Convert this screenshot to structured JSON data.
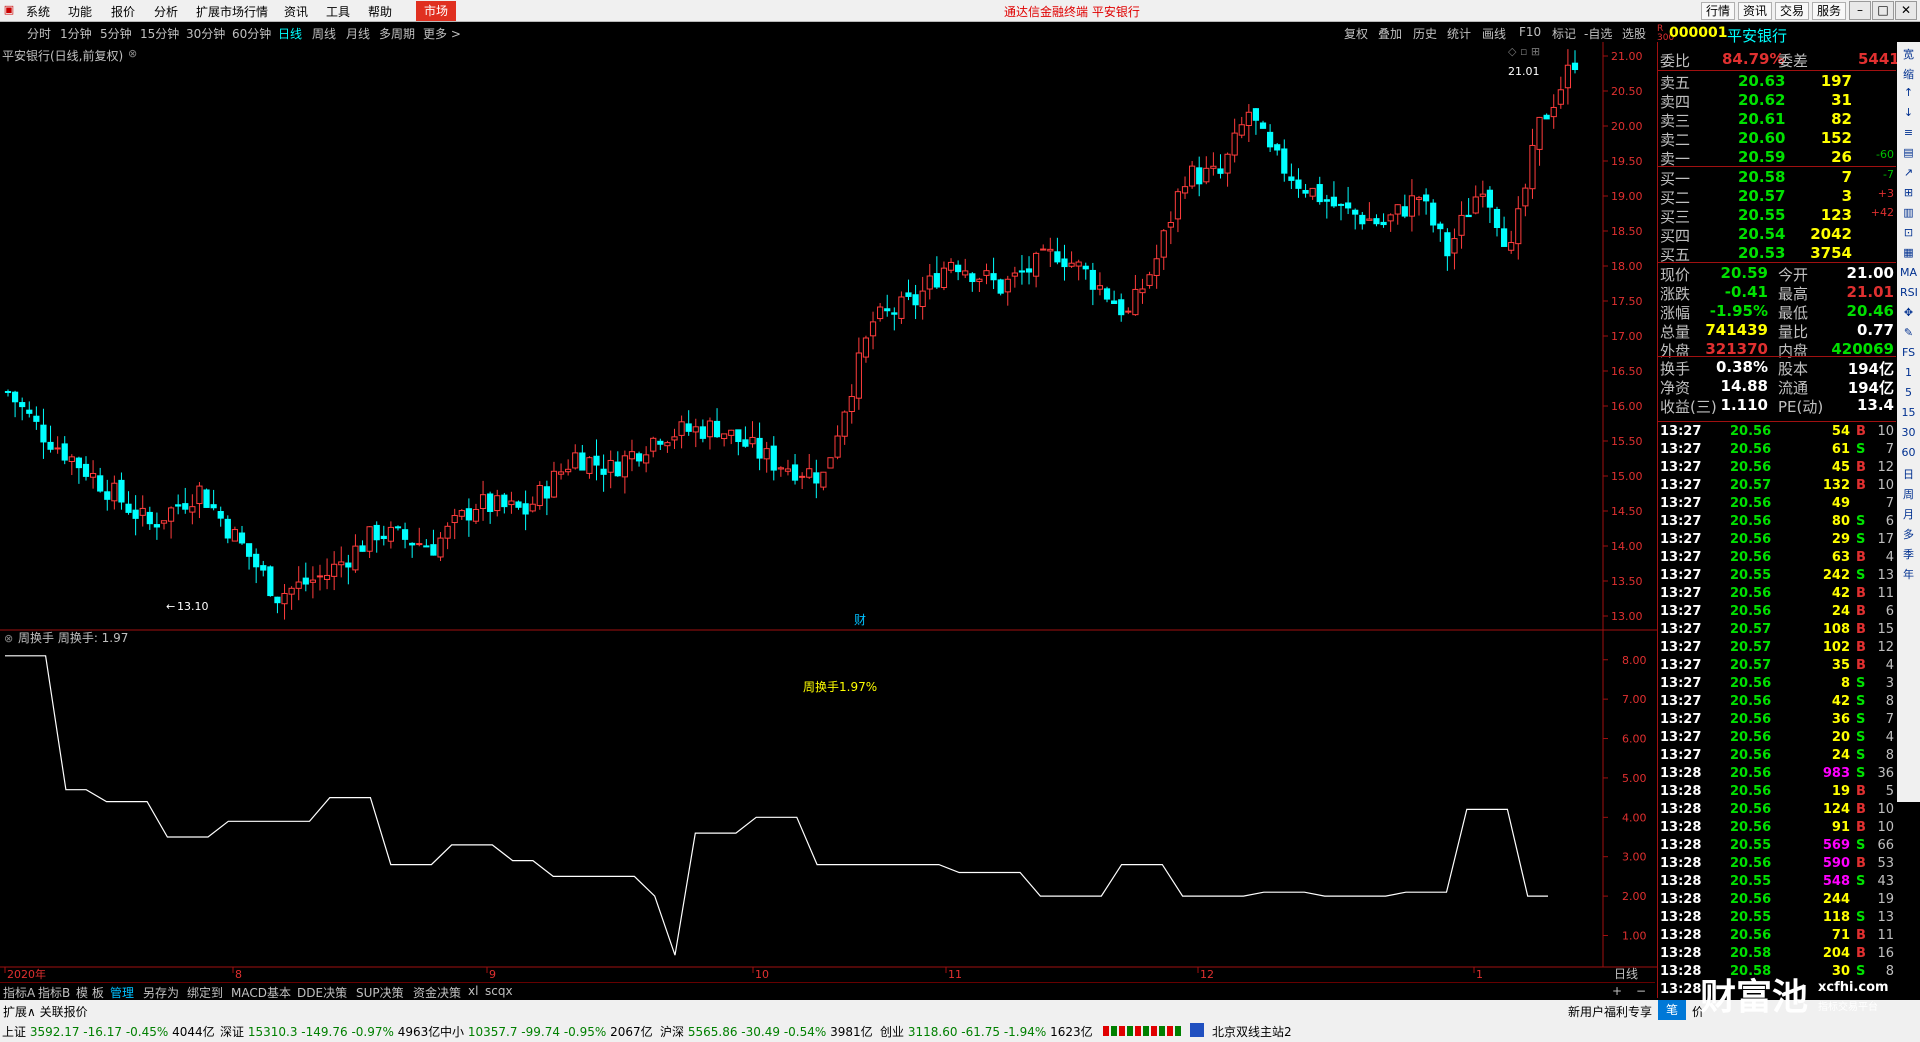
{
  "menu": {
    "items": [
      "系统",
      "功能",
      "报价",
      "分析",
      "扩展市场行情",
      "资讯",
      "工具",
      "帮助"
    ],
    "market_tab": "市场",
    "brand": "通达信金融终端  平安银行",
    "right_buttons": [
      "行情",
      "资讯",
      "交易",
      "服务"
    ],
    "window_controls": [
      "–",
      "□",
      "✕"
    ]
  },
  "period_bar": {
    "periods": [
      "分时",
      "1分钟",
      "5分钟",
      "15分钟",
      "30分钟",
      "60分钟",
      "日线",
      "周线",
      "月线",
      "多周期",
      "更多 >"
    ],
    "active": "日线",
    "tools": [
      "复权",
      "叠加",
      "历史",
      "统计",
      "画线",
      "F10",
      "标记",
      "-自选",
      "选股"
    ]
  },
  "chart_title": "平安银行(日线,前复权)",
  "chart_annotations": {
    "high_label": "21.01",
    "low_label": "13.10",
    "fin_marker": "财"
  },
  "indicator": {
    "title": "周换手  周换手: 1.97",
    "center_label": "周换手1.97%",
    "y_ticks": [
      "8.00",
      "7.00",
      "6.00",
      "5.00",
      "4.00",
      "3.00",
      "2.00",
      "1.00"
    ]
  },
  "price_y_ticks": [
    "21.00",
    "20.50",
    "20.00",
    "19.50",
    "19.00",
    "18.50",
    "18.00",
    "17.50",
    "17.00",
    "16.50",
    "16.00",
    "15.50",
    "15.00",
    "14.50",
    "14.00",
    "13.50",
    "13.00"
  ],
  "x_axis": {
    "labels": [
      "2020年",
      "8",
      "9",
      "10",
      "11",
      "12",
      "1"
    ],
    "period_label": "日线"
  },
  "colors": {
    "up": "#ff3c3c",
    "down": "#00ffff",
    "line": "#ffffff",
    "label_yellow": "#ffff00",
    "grid_red": "#a01010"
  },
  "chart_data": {
    "type": "candlestick",
    "ylim": [
      12.8,
      21.2
    ],
    "high": 21.01,
    "low": 13.1,
    "last_close": 20.59,
    "indicator_series": {
      "name": "周换手",
      "ylim": [
        0.2,
        8.4
      ],
      "values": [
        8.1,
        8.1,
        8.1,
        4.7,
        4.7,
        4.4,
        4.4,
        4.4,
        3.5,
        3.5,
        3.5,
        3.9,
        3.9,
        3.9,
        3.9,
        3.9,
        4.5,
        4.5,
        4.5,
        2.8,
        2.8,
        2.8,
        3.3,
        3.3,
        3.3,
        2.9,
        2.9,
        2.5,
        2.5,
        2.5,
        2.5,
        2.5,
        2.0,
        0.5,
        3.6,
        3.6,
        3.6,
        4.0,
        4.0,
        4.0,
        2.8,
        2.8,
        2.8,
        2.8,
        2.8,
        2.8,
        2.8,
        2.6,
        2.6,
        2.6,
        2.6,
        2.0,
        2.0,
        2.0,
        2.0,
        2.8,
        2.8,
        2.8,
        2.0,
        2.0,
        2.0,
        2.0,
        2.1,
        2.1,
        2.1,
        2.0,
        2.0,
        2.0,
        2.0,
        2.1,
        2.1,
        2.1,
        4.2,
        4.2,
        4.2,
        2.0,
        2.0
      ]
    }
  },
  "quote": {
    "code": "000001",
    "name": "平安银行",
    "weibi_label": "委比",
    "weibi": "84.79%",
    "weicha_label": "委差",
    "weicha": "5441",
    "asks": [
      {
        "label": "卖五",
        "price": "20.63",
        "vol": "197",
        "chg": ""
      },
      {
        "label": "卖四",
        "price": "20.62",
        "vol": "31",
        "chg": ""
      },
      {
        "label": "卖三",
        "price": "20.61",
        "vol": "82",
        "chg": ""
      },
      {
        "label": "卖二",
        "price": "20.60",
        "vol": "152",
        "chg": ""
      },
      {
        "label": "卖一",
        "price": "20.59",
        "vol": "26",
        "chg": "-60"
      }
    ],
    "bids": [
      {
        "label": "买一",
        "price": "20.58",
        "vol": "7",
        "chg": "-7"
      },
      {
        "label": "买二",
        "price": "20.57",
        "vol": "3",
        "chg": "+3"
      },
      {
        "label": "买三",
        "price": "20.55",
        "vol": "123",
        "chg": "+42"
      },
      {
        "label": "买四",
        "price": "20.54",
        "vol": "2042",
        "chg": ""
      },
      {
        "label": "买五",
        "price": "20.53",
        "vol": "3754",
        "chg": ""
      }
    ],
    "stats": [
      {
        "l1": "现价",
        "v1": "20.59",
        "l2": "今开",
        "v2": "21.00"
      },
      {
        "l1": "涨跌",
        "v1": "-0.41",
        "l2": "最高",
        "v2": "21.01"
      },
      {
        "l1": "涨幅",
        "v1": "-1.95%",
        "l2": "最低",
        "v2": "20.46"
      },
      {
        "l1": "总量",
        "v1": "741439",
        "l2": "量比",
        "v2": "0.77"
      },
      {
        "l1": "外盘",
        "v1": "321370",
        "l2": "内盘",
        "v2": "420069"
      }
    ],
    "stats2": [
      {
        "l1": "换手",
        "v1": "0.38%",
        "l2": "股本",
        "v2": "194亿"
      },
      {
        "l1": "净资",
        "v1": "14.88",
        "l2": "流通",
        "v2": "194亿"
      },
      {
        "l1": "收益(三)",
        "v1": "1.110",
        "l2": "PE(动)",
        "v2": "13.4"
      }
    ]
  },
  "ticks": [
    {
      "t": "13:27",
      "p": "20.56",
      "v": "54",
      "d": "B",
      "n": "10"
    },
    {
      "t": "13:27",
      "p": "20.56",
      "v": "61",
      "d": "S",
      "n": "7"
    },
    {
      "t": "13:27",
      "p": "20.56",
      "v": "45",
      "d": "B",
      "n": "12"
    },
    {
      "t": "13:27",
      "p": "20.57",
      "v": "132",
      "d": "B",
      "n": "10"
    },
    {
      "t": "13:27",
      "p": "20.56",
      "v": "49",
      "d": "",
      "n": "7"
    },
    {
      "t": "13:27",
      "p": "20.56",
      "v": "80",
      "d": "S",
      "n": "6"
    },
    {
      "t": "13:27",
      "p": "20.56",
      "v": "29",
      "d": "S",
      "n": "17"
    },
    {
      "t": "13:27",
      "p": "20.56",
      "v": "63",
      "d": "B",
      "n": "4"
    },
    {
      "t": "13:27",
      "p": "20.55",
      "v": "242",
      "d": "S",
      "n": "13"
    },
    {
      "t": "13:27",
      "p": "20.56",
      "v": "42",
      "d": "B",
      "n": "11"
    },
    {
      "t": "13:27",
      "p": "20.56",
      "v": "24",
      "d": "B",
      "n": "6"
    },
    {
      "t": "13:27",
      "p": "20.57",
      "v": "108",
      "d": "B",
      "n": "15"
    },
    {
      "t": "13:27",
      "p": "20.57",
      "v": "102",
      "d": "B",
      "n": "12"
    },
    {
      "t": "13:27",
      "p": "20.57",
      "v": "35",
      "d": "B",
      "n": "4"
    },
    {
      "t": "13:27",
      "p": "20.56",
      "v": "8",
      "d": "S",
      "n": "3"
    },
    {
      "t": "13:27",
      "p": "20.56",
      "v": "42",
      "d": "S",
      "n": "8"
    },
    {
      "t": "13:27",
      "p": "20.56",
      "v": "36",
      "d": "S",
      "n": "7"
    },
    {
      "t": "13:27",
      "p": "20.56",
      "v": "20",
      "d": "S",
      "n": "4"
    },
    {
      "t": "13:27",
      "p": "20.56",
      "v": "24",
      "d": "S",
      "n": "8"
    },
    {
      "t": "13:28",
      "p": "20.56",
      "v": "983",
      "d": "S",
      "n": "36"
    },
    {
      "t": "13:28",
      "p": "20.56",
      "v": "19",
      "d": "B",
      "n": "5"
    },
    {
      "t": "13:28",
      "p": "20.56",
      "v": "124",
      "d": "B",
      "n": "10"
    },
    {
      "t": "13:28",
      "p": "20.56",
      "v": "91",
      "d": "B",
      "n": "10"
    },
    {
      "t": "13:28",
      "p": "20.55",
      "v": "569",
      "d": "S",
      "n": "66"
    },
    {
      "t": "13:28",
      "p": "20.56",
      "v": "590",
      "d": "B",
      "n": "53"
    },
    {
      "t": "13:28",
      "p": "20.55",
      "v": "548",
      "d": "S",
      "n": "43"
    },
    {
      "t": "13:28",
      "p": "20.56",
      "v": "244",
      "d": "",
      "n": "19"
    },
    {
      "t": "13:28",
      "p": "20.55",
      "v": "118",
      "d": "S",
      "n": "13"
    },
    {
      "t": "13:28",
      "p": "20.56",
      "v": "71",
      "d": "B",
      "n": "11"
    },
    {
      "t": "13:28",
      "p": "20.58",
      "v": "204",
      "d": "B",
      "n": "16"
    },
    {
      "t": "13:28",
      "p": "20.58",
      "v": "30",
      "d": "S",
      "n": "8"
    },
    {
      "t": "13:28",
      "p": "",
      "v": "",
      "d": "",
      "n": ""
    }
  ],
  "side_icons": [
    "宽",
    "缩",
    "↑",
    "↓",
    "≡",
    "▤",
    "↗",
    "⊞",
    "▥",
    "⊡",
    "▦",
    "MA",
    "RSI",
    "✥",
    "✎",
    "FS",
    "1",
    "5",
    "15",
    "30",
    "60",
    "日",
    "周",
    "月",
    "多",
    "季",
    "年"
  ],
  "bottom_tabs": [
    "指标A",
    "指标B",
    "模 板",
    "管理",
    "另存为",
    "绑定到",
    "MACD基本",
    "DDE决策",
    "SUP决策",
    "资金决策",
    "xl",
    "scqx"
  ],
  "bottom_active": "管理",
  "ext_bar": {
    "left": "扩展∧  关联报价",
    "notice": "新用户福利专享",
    "tab": "笔",
    "tab2": "价"
  },
  "status": {
    "indices": [
      {
        "name": "上证",
        "val": "3592.17",
        "chg": "-16.17",
        "pct": "-0.45%",
        "amt": "4044亿"
      },
      {
        "name": "深证",
        "val": "15310.3",
        "chg": "-149.76",
        "pct": "-0.97%",
        "amt": "4963亿"
      },
      {
        "name": "中小",
        "val": "10357.7",
        "chg": "-99.74",
        "pct": "-0.95%",
        "amt": "2067亿"
      },
      {
        "name": "沪深",
        "val": "5565.86",
        "chg": "-30.49",
        "pct": "-0.54%",
        "amt": "3981亿"
      },
      {
        "name": "创业",
        "val": "3118.60",
        "chg": "-61.75",
        "pct": "-1.94%",
        "amt": "1623亿"
      }
    ],
    "server": "北京双线主站2"
  },
  "watermark": {
    "logo": "财富池",
    "url": "xcfhi.com",
    "sub": "指标交易平台"
  }
}
